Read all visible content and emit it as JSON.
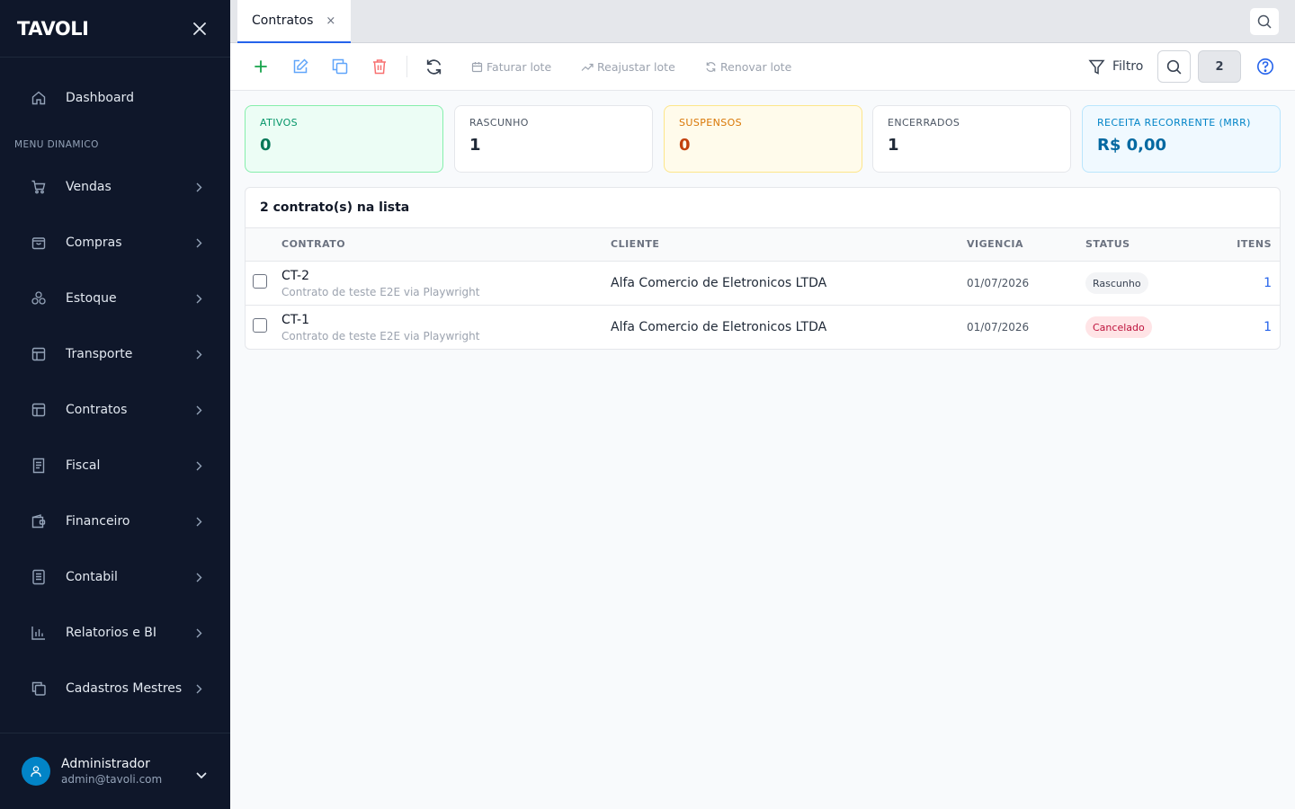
{
  "app": {
    "logo_text": "TAVOLI"
  },
  "sidebar": {
    "dashboard_label": "Dashboard",
    "section_label": "MENU DINAMICO",
    "items": [
      {
        "label": "Vendas",
        "icon": "cart-icon"
      },
      {
        "label": "Compras",
        "icon": "shopping-bag-icon"
      },
      {
        "label": "Estoque",
        "icon": "boxes-icon"
      },
      {
        "label": "Transporte",
        "icon": "layout-icon"
      },
      {
        "label": "Contratos",
        "icon": "layout-icon"
      },
      {
        "label": "Fiscal",
        "icon": "receipt-icon"
      },
      {
        "label": "Financeiro",
        "icon": "wallet-icon"
      },
      {
        "label": "Contabil",
        "icon": "ledger-icon"
      },
      {
        "label": "Relatorios e BI",
        "icon": "bar-chart-icon"
      },
      {
        "label": "Cadastros Mestres",
        "icon": "copy-icon"
      }
    ],
    "user": {
      "name": "Administrador",
      "email": "admin@tavoli.com"
    }
  },
  "tabs": [
    {
      "label": "Contratos",
      "close": "×"
    }
  ],
  "toolbar": {
    "faturar_label": "Faturar lote",
    "reajustar_label": "Reajustar lote",
    "renovar_label": "Renovar lote",
    "filter_label": "Filtro",
    "count": "2"
  },
  "kpis": [
    {
      "label": "ATIVOS",
      "value": "0"
    },
    {
      "label": "RASCUNHO",
      "value": "1"
    },
    {
      "label": "SUSPENSOS",
      "value": "0"
    },
    {
      "label": "ENCERRADOS",
      "value": "1"
    },
    {
      "label": "RECEITA RECORRENTE (MRR)",
      "value": "R$ 0,00"
    }
  ],
  "table": {
    "title": "2 contrato(s) na lista",
    "columns": {
      "contrato": "CONTRATO",
      "cliente": "CLIENTE",
      "vigencia": "VIGENCIA",
      "status": "STATUS",
      "itens": "ITENS"
    },
    "rows": [
      {
        "code": "CT-2",
        "description": "Contrato de teste E2E via Playwright",
        "client": "Alfa Comercio de Eletronicos LTDA",
        "date": "01/07/2026",
        "status": "Rascunho",
        "items": "1"
      },
      {
        "code": "CT-1",
        "description": "Contrato de teste E2E via Playwright",
        "client": "Alfa Comercio de Eletronicos LTDA",
        "date": "01/07/2026",
        "status": "Cancelado",
        "items": "1"
      }
    ]
  },
  "colors": {
    "sidebar_bg": "#0f172a",
    "accent": "#2563eb",
    "success": "#047857",
    "warning": "#c2410c",
    "info": "#0369a1",
    "danger": "#be123c"
  }
}
